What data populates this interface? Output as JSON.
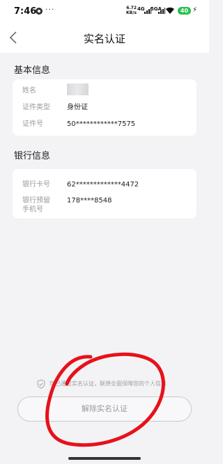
{
  "status_bar": {
    "time": "7:46",
    "dots": "···",
    "speed_value": "6.72",
    "speed_unit": "KB/s",
    "net1": "4G",
    "net2": "5GA",
    "battery": "40",
    "battery_color": "#27c24c"
  },
  "nav": {
    "title": "实名认证",
    "back_icon": "chevron-left-icon"
  },
  "basic_info": {
    "title": "基本信息",
    "rows": [
      {
        "label": "姓名",
        "value": ""
      },
      {
        "label": "证件类型",
        "value": "身份证"
      },
      {
        "label": "证件号",
        "value": "50************7575"
      }
    ]
  },
  "bank_info": {
    "title": "银行信息",
    "rows": [
      {
        "label": "银行卡号",
        "value": "62*************4472"
      },
      {
        "label": "银行预留",
        "label2": "手机号",
        "value": "178****8548"
      }
    ]
  },
  "notice": {
    "icon": "shield-check-icon",
    "text": "您已通过实名认证，联想全面保障您的个人信息"
  },
  "actions": {
    "unbind_label": "解除实名认证"
  },
  "colors": {
    "background": "#f3f3f5",
    "annotation_red": "#e8111b"
  }
}
